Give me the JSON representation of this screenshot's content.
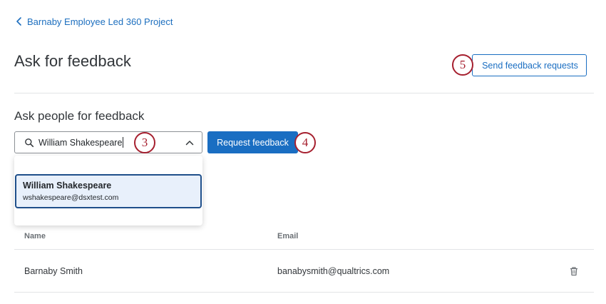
{
  "breadcrumb": {
    "label": "Barnaby Employee Led 360 Project"
  },
  "page": {
    "title": "Ask for feedback"
  },
  "header": {
    "send_button": "Send feedback requests"
  },
  "section": {
    "title": "Ask people for feedback"
  },
  "search": {
    "value": "William Shakespeare"
  },
  "actions": {
    "request_button": "Request feedback"
  },
  "dropdown": {
    "options": [
      {
        "name": "William Shakespeare",
        "email": "wshakespeare@dsxtest.com"
      }
    ]
  },
  "table": {
    "columns": [
      "Name",
      "Email"
    ],
    "rows": [
      {
        "name": "Barnaby Smith",
        "email": "banabysmith@qualtrics.com"
      }
    ]
  },
  "markers": {
    "m3": "3",
    "m4": "4",
    "m5": "5"
  },
  "colors": {
    "accent": "#1a6ec2",
    "marker": "#a6202f",
    "selected_bg": "#e8f0fb"
  },
  "icons": {
    "breadcrumb": "chevron-left-icon",
    "search": "search-icon",
    "combobox": "chevron-up-icon",
    "row_action": "trash-icon"
  }
}
